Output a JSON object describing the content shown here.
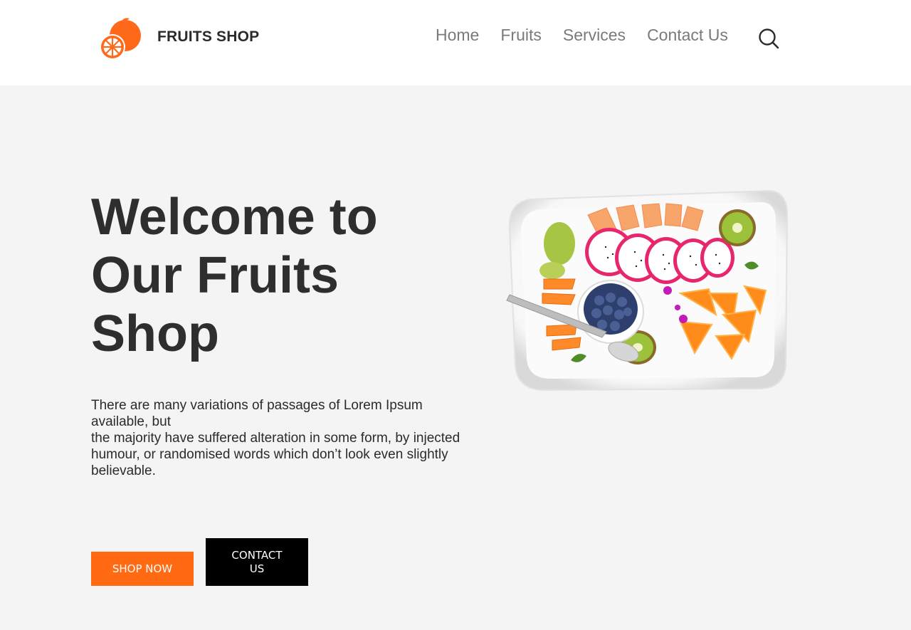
{
  "header": {
    "brand": "FRUITS SHOP",
    "logo_icon": "orange-fruit-icon",
    "nav": [
      {
        "label": "Home"
      },
      {
        "label": "Fruits"
      },
      {
        "label": "Services"
      },
      {
        "label": "Contact Us"
      }
    ],
    "search_icon": "search-icon"
  },
  "hero": {
    "title_lines": [
      "Welcome to",
      "Our Fruits",
      "Shop"
    ],
    "text_lines": [
      "There are many variations of passages of Lorem Ipsum available, but",
      "the majority have suffered alteration in some form, by injected",
      "humour, or randomised words which don’t look even slightly believable."
    ],
    "shop_button": "SHOP NOW",
    "contact_button": "CONTACT US",
    "image_alt": "fruit-platter-image"
  },
  "colors": {
    "accent": "#ff6a13",
    "header_bg": "#ffffff",
    "page_bg": "#f4f4f4",
    "dark_button": "#000000",
    "heading": "#2e2e2e",
    "nav_text": "#7a7a7a"
  }
}
